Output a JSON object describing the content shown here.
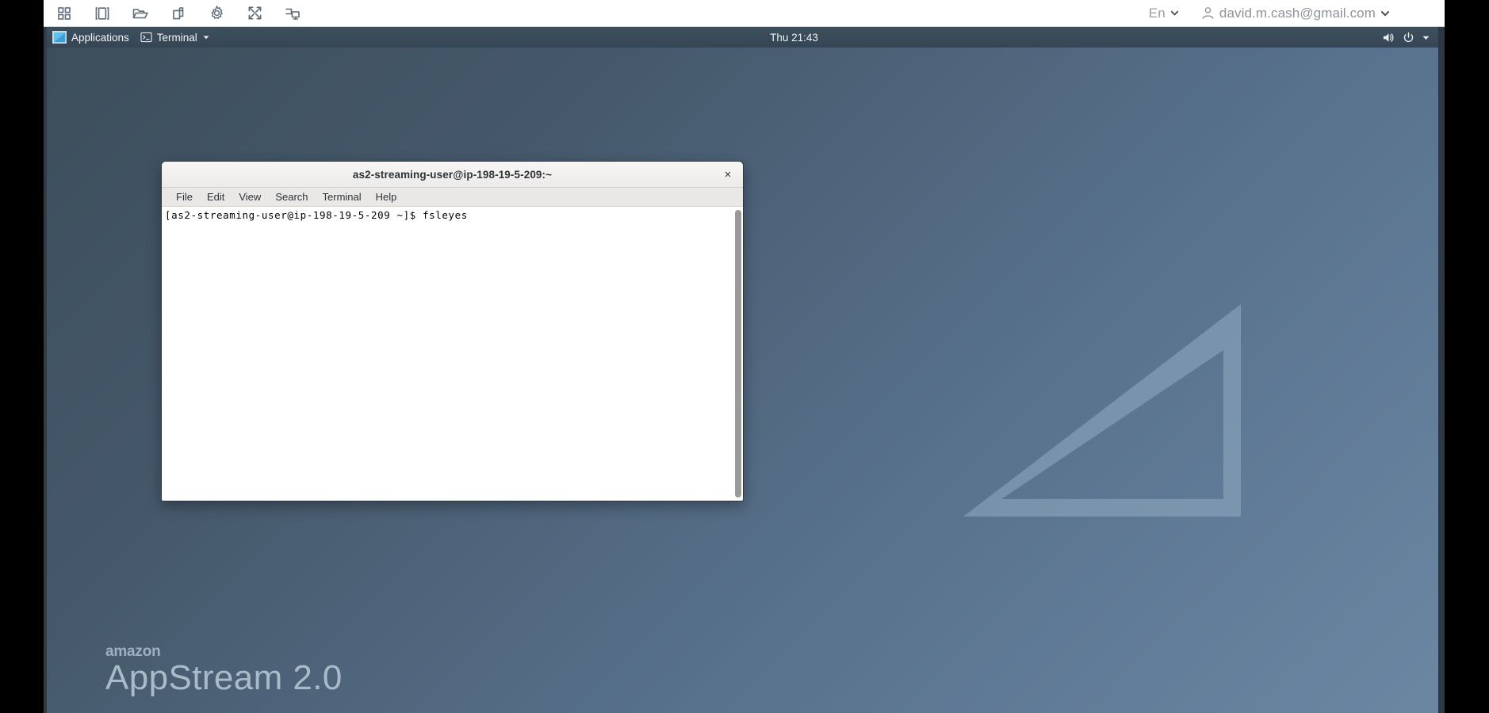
{
  "appstream_toolbar": {
    "icons": [
      {
        "name": "grid-apps-icon",
        "label": "Applications grid"
      },
      {
        "name": "panel-toggle-icon",
        "label": "Toggle panel"
      },
      {
        "name": "folder-open-icon",
        "label": "My Files"
      },
      {
        "name": "copy-clipboard-icon",
        "label": "Clipboard"
      },
      {
        "name": "gear-icon",
        "label": "Settings"
      },
      {
        "name": "fullscreen-icon",
        "label": "Fullscreen"
      },
      {
        "name": "switch-session-icon",
        "label": "Switch session"
      }
    ],
    "language": "En",
    "user_email": "david.m.cash@gmail.com"
  },
  "gnome_panel": {
    "applications_label": "Applications",
    "window_label": "Terminal",
    "clock": "Thu 21:43",
    "tray": [
      {
        "name": "volume-icon"
      },
      {
        "name": "power-icon"
      },
      {
        "name": "chevron-down-icon"
      }
    ]
  },
  "terminal": {
    "title": "as2-streaming-user@ip-198-19-5-209:~",
    "close_label": "×",
    "menu": [
      "File",
      "Edit",
      "View",
      "Search",
      "Terminal",
      "Help"
    ],
    "content": "[as2-streaming-user@ip-198-19-5-209 ~]$ fsleyes"
  },
  "desktop": {
    "brand_top": "amazon",
    "brand_main": "AppStream 2.0",
    "watermark_name": "triangle-watermark"
  },
  "colors": {
    "desktop_top_left": "#3c4e5b",
    "desktop_bottom_right": "#6b87a2",
    "panel": "#3d4f5d",
    "toolbar_bg": "#ffffff",
    "terminal_bg": "#ffffff",
    "watermark": "#8fa9c1"
  }
}
